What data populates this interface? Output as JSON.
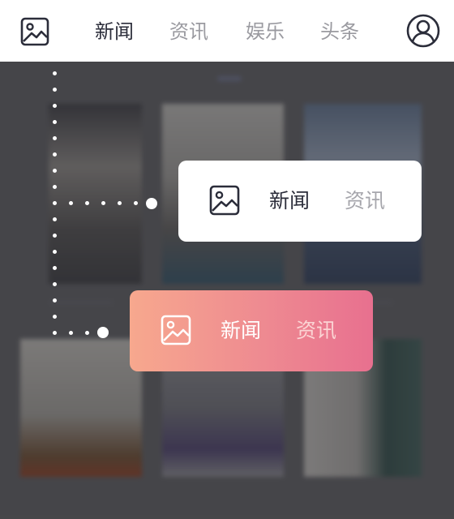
{
  "header": {
    "tabs": [
      {
        "label": "新闻",
        "active": true
      },
      {
        "label": "资讯",
        "active": false
      },
      {
        "label": "娱乐",
        "active": false
      },
      {
        "label": "头条",
        "active": false
      }
    ],
    "left_icon": "image-icon",
    "right_icon": "user-avatar-icon"
  },
  "cards": [
    {
      "variant": "white",
      "icon": "image-icon",
      "tabs": [
        {
          "label": "新闻",
          "active": true
        },
        {
          "label": "资讯",
          "active": false
        }
      ]
    },
    {
      "variant": "gradient",
      "gradient": [
        "#f7a88e",
        "#e8708f"
      ],
      "icon": "image-icon",
      "tabs": [
        {
          "label": "新闻",
          "active": true
        },
        {
          "label": "资讯",
          "active": false
        }
      ]
    }
  ],
  "colors": {
    "active_text": "#2b2d3a",
    "inactive_text": "#9a9aa0",
    "overlay": "#4a4a4c"
  }
}
